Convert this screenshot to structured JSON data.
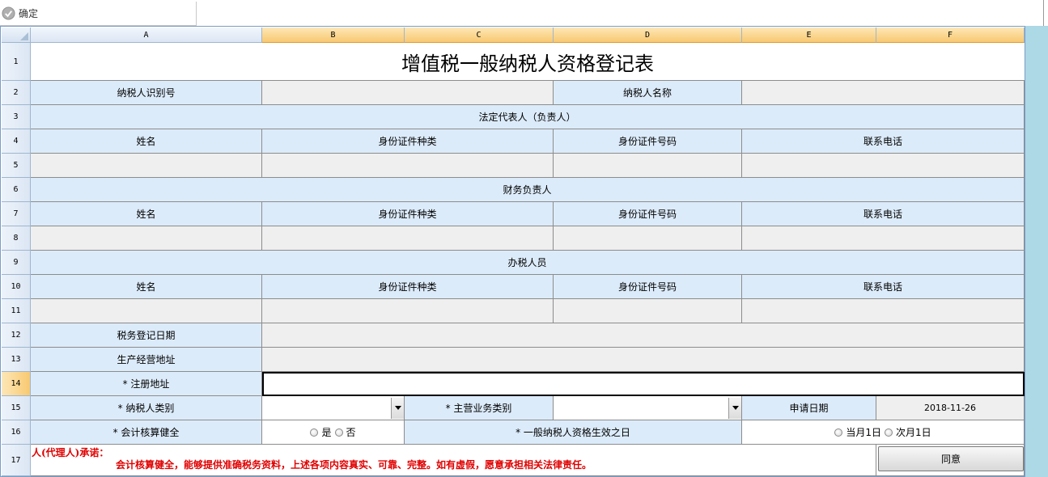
{
  "toolbar": {
    "confirm_label": "确定"
  },
  "columns": [
    "A",
    "B",
    "C",
    "D",
    "E",
    "F"
  ],
  "rows": [
    "1",
    "2",
    "3",
    "4",
    "5",
    "6",
    "7",
    "8",
    "9",
    "10",
    "11",
    "12",
    "13",
    "14",
    "15",
    "16",
    "17"
  ],
  "form": {
    "title": "增值税一般纳税人资格登记表",
    "taxpayer_id_label": "纳税人识别号",
    "taxpayer_id_value": "",
    "taxpayer_name_label": "纳税人名称",
    "taxpayer_name_value": "",
    "legal_rep_section": "法定代表人（负责人）",
    "finance_section": "财务负责人",
    "tax_staff_section": "办税人员",
    "col_name": "姓名",
    "col_id_type": "身份证件种类",
    "col_id_number": "身份证件号码",
    "col_phone": "联系电话",
    "tax_reg_date_label": "税务登记日期",
    "tax_reg_date_value": "",
    "biz_address_label": "生产经营地址",
    "biz_address_value": "",
    "reg_address_label": "* 注册地址",
    "reg_address_value": "",
    "taxpayer_type_label": "* 纳税人类别",
    "taxpayer_type_value": "",
    "main_biz_type_label": "* 主营业务类别",
    "main_biz_type_value": "",
    "apply_date_label": "申请日期",
    "apply_date_value": "2018-11-26",
    "accounting_label": "* 会计核算健全",
    "accounting_yes": "是",
    "accounting_no": "否",
    "effective_label": "* 一般纳税人资格生效之日",
    "effective_this_month": "当月1日",
    "effective_next_month": "次月1日",
    "promise_title": "人(代理人)承诺：",
    "promise_text": "会计核算健全，能够提供准确税务资料，上述各项内容真实、可靠、完整。如有虚假，愿意承担相关法律责任。",
    "agree_label": "同意"
  },
  "colors": {
    "label_bg": "#dcebfa",
    "input_bg": "#efefef",
    "selected_header": "#f8c971",
    "promise_text": "#e00000",
    "side_bg": "#add8e6"
  }
}
